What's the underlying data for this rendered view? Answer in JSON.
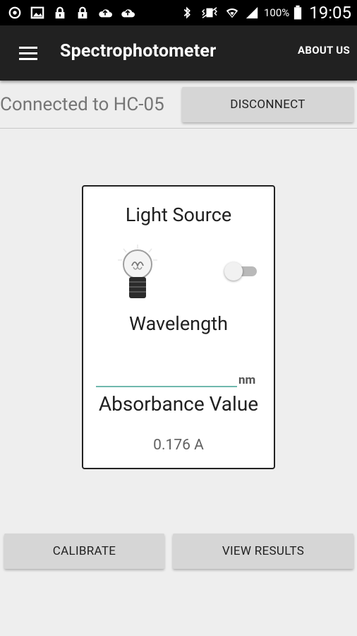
{
  "status_bar": {
    "battery_percent": "100%",
    "time": "19:05",
    "left_icons": [
      "sync-icon",
      "image-icon",
      "lock-icon",
      "lock-icon",
      "cloud-upload-icon",
      "cloud-upload-icon"
    ],
    "right_icons": [
      "bluetooth-icon",
      "vibrate-icon",
      "wifi-icon",
      "signal-icon",
      "battery-icon"
    ]
  },
  "app_bar": {
    "title": "Spectrophotometer",
    "action_label": "ABOUT US"
  },
  "connection": {
    "status_text": "Connected to HC-05",
    "disconnect_label": "DISCONNECT"
  },
  "card": {
    "light_source_label": "Light Source",
    "light_source_on": false,
    "wavelength_label": "Wavelength",
    "wavelength_value": "",
    "wavelength_unit": "nm",
    "absorbance_label": "Absorbance Value",
    "absorbance_value": "0.176 A"
  },
  "actions": {
    "calibrate_label": "CALIBRATE",
    "view_results_label": "VIEW RESULTS"
  },
  "colors": {
    "app_bar": "#212121",
    "background": "#eeeeee",
    "accent": "#6fb8ad",
    "button": "#d6d6d6"
  }
}
